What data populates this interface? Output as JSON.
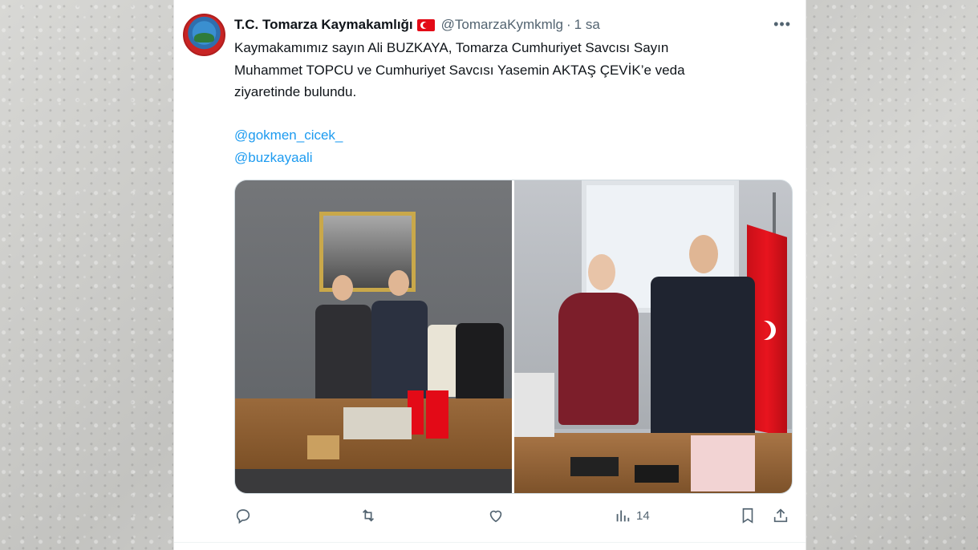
{
  "tweet": {
    "author_name": "T.C. Tomarza Kaymakamlığı",
    "handle": "@TomarzaKymkmlg",
    "separator": "·",
    "time": "1 sa",
    "more_label": "•••",
    "text_line1": "Kaymakamımız sayın Ali BUZKAYA, Tomarza Cumhuriyet Savcısı Sayın",
    "text_line2": "Muhammet TOPCU ve Cumhuriyet Savcısı Yasemin AKTAŞ ÇEVİK’e veda",
    "text_line3": "ziyaretinde bulundu.",
    "mentions": [
      "@gokmen_cicek_",
      "@buzkayaali"
    ]
  },
  "actions": {
    "views_count": "14"
  },
  "icons": {
    "reply": "reply-icon",
    "retweet": "retweet-icon",
    "like": "like-icon",
    "views": "views-icon",
    "bookmark": "bookmark-icon",
    "share": "share-icon",
    "more": "more-icon",
    "flag": "turkish-flag-emoji"
  },
  "colors": {
    "link": "#1d9bf0",
    "text": "#0f1419",
    "muted": "#536471",
    "flag_red": "#e30a17"
  }
}
